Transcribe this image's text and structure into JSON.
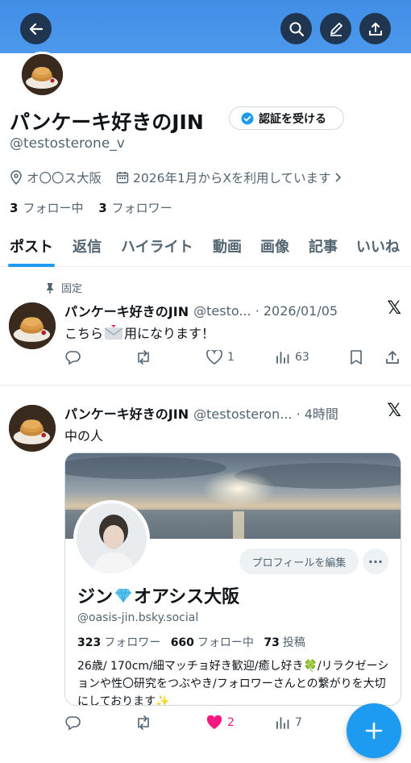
{
  "profile": {
    "name": "パンケーキ好きのJIN",
    "verify_label": "認証を受ける",
    "handle": "@testosterone_v",
    "location": "オ〇〇ス大阪",
    "joined": "2026年1月からXを利用しています",
    "following_count": "3",
    "following_label": "フォロー中",
    "followers_count": "3",
    "followers_label": "フォロワー"
  },
  "tabs": [
    {
      "label": "ポスト"
    },
    {
      "label": "返信"
    },
    {
      "label": "ハイライト"
    },
    {
      "label": "動画"
    },
    {
      "label": "画像"
    },
    {
      "label": "記事"
    },
    {
      "label": "いいね"
    }
  ],
  "posts": [
    {
      "pinned_label": "固定",
      "name": "パンケーキ好きのJIN",
      "handle_time": "@testo... · 2026/01/05",
      "text_before": "こちら",
      "text_after": "用になります！",
      "replies": "",
      "reposts": "",
      "likes": "1",
      "views": "63"
    },
    {
      "name": "パンケーキ好きのJIN",
      "handle_time": "@testosteron... · 4時間",
      "text": "中の人",
      "replies": "",
      "reposts": "",
      "likes": "2",
      "views": "7"
    }
  ],
  "card": {
    "edit_label": "プロフィールを編集",
    "more_label": "···",
    "name_before": "ジン",
    "name_after": "オアシス大阪",
    "handle": "@oasis-jin.bsky.social",
    "followers_count": "323",
    "followers_label": "フォロワー",
    "following_count": "660",
    "following_label": "フォロー中",
    "posts_count": "73",
    "posts_label": "投稿",
    "bio": "26歳/ 170cm/細マッチョ好き歓迎/癒し好き🍀/リラクゼーションや性〇研究をつぶやき/フォロワーさんとの繋がりを大切にしております✨"
  },
  "colors": {
    "accent": "#1d9bf0",
    "banner": "#4a95ea",
    "like": "#f91880"
  },
  "icons": [
    "back-arrow-icon",
    "search-icon",
    "edit-icon",
    "share-icon",
    "location-icon",
    "calendar-icon",
    "pin-icon",
    "x-logo-icon",
    "reply-icon",
    "repost-icon",
    "heart-icon",
    "views-icon",
    "bookmark-icon",
    "compose-icon"
  ]
}
